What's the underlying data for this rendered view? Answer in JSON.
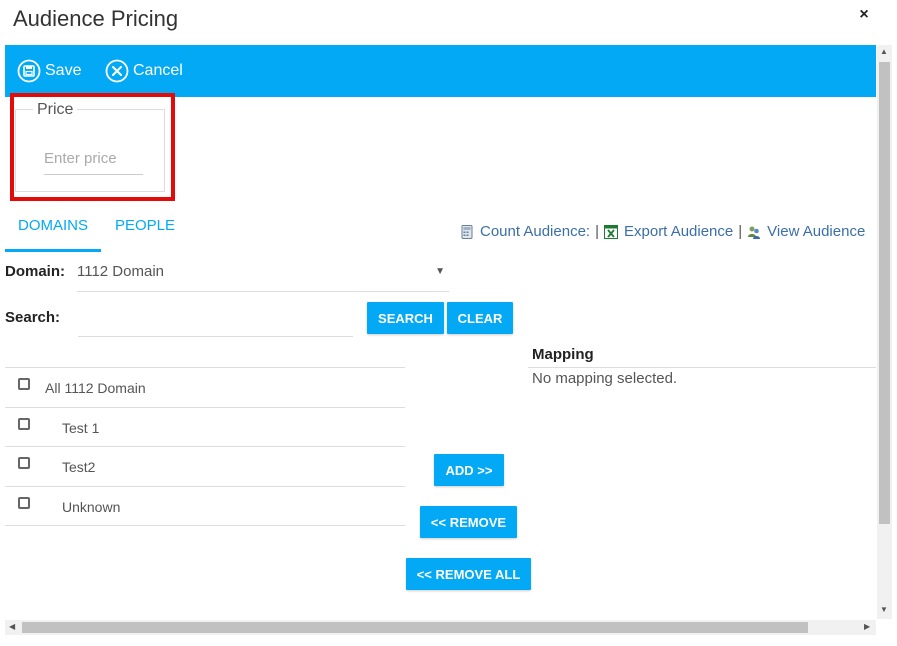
{
  "dialog": {
    "title": "Audience Pricing",
    "close_glyph": "×"
  },
  "toolbar": {
    "save_label": "Save",
    "cancel_label": "Cancel",
    "color": "#03a9f4"
  },
  "price": {
    "legend": "Price",
    "placeholder": "Enter price",
    "value": ""
  },
  "tabs": [
    {
      "label": "DOMAINS",
      "active": true
    },
    {
      "label": "PEOPLE",
      "active": false
    }
  ],
  "audience_actions": {
    "count_label": "Count Audience:",
    "export_label": "Export Audience",
    "view_label": "View Audience",
    "separator": "|"
  },
  "domain": {
    "label": "Domain:",
    "selected": "1112 Domain"
  },
  "search": {
    "label": "Search:",
    "value": "",
    "search_button": "SEARCH",
    "clear_button": "CLEAR"
  },
  "list": {
    "items": [
      {
        "label": "All 1112 Domain",
        "checked": false
      },
      {
        "label": "Test 1",
        "checked": false
      },
      {
        "label": "Test2",
        "checked": false
      },
      {
        "label": "Unknown",
        "checked": false
      }
    ]
  },
  "mapping": {
    "heading": "Mapping",
    "empty_text": "No mapping selected."
  },
  "transfer": {
    "add_label": "ADD >>",
    "remove_label": "<< REMOVE",
    "remove_all_label": "<< REMOVE ALL"
  },
  "highlight_color": "#e30a0a"
}
